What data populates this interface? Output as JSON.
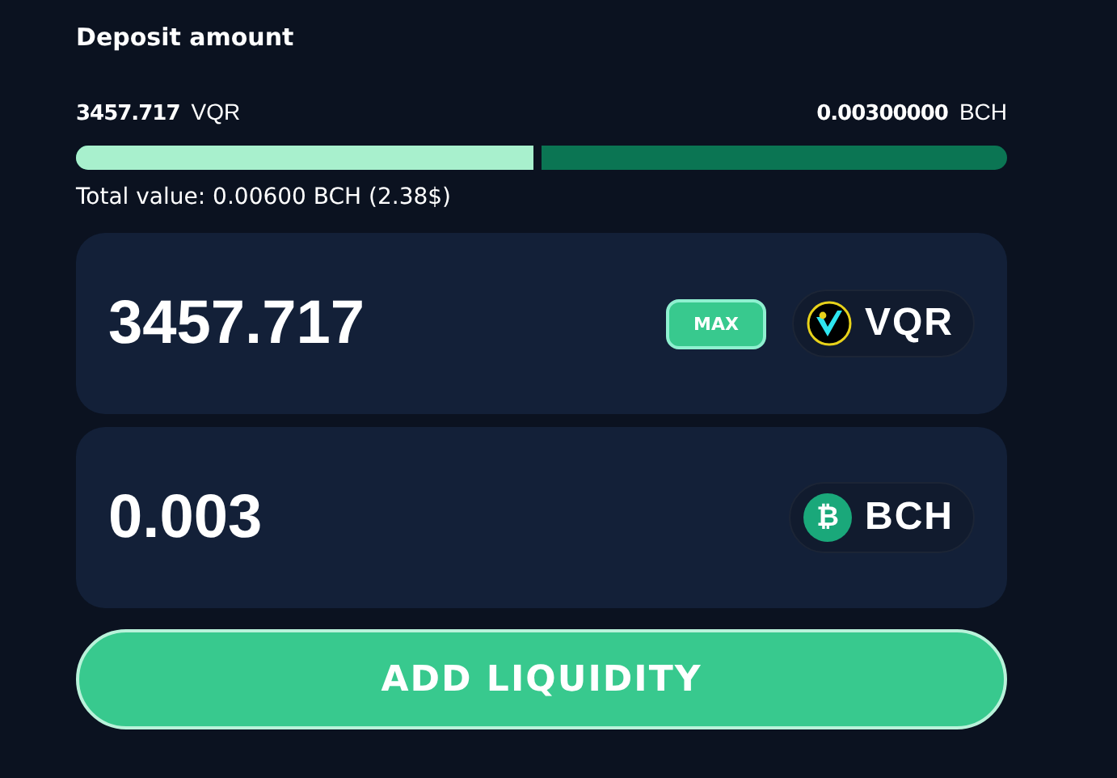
{
  "title": "Deposit amount",
  "ratio": {
    "left_amount": "3457.717",
    "left_token": "VQR",
    "right_amount": "0.00300000",
    "right_token": "BCH",
    "level": 0.5
  },
  "total_value": "Total value: 0.00600 BCH (2.38$)",
  "inputs": [
    {
      "value": "3457.717",
      "max_label": "MAX",
      "token": "VQR",
      "kind": "vqr"
    },
    {
      "value": "0.003",
      "token": "BCH",
      "kind": "bch",
      "glyph": "₿"
    }
  ],
  "submit": "ADD LIQUIDITY"
}
